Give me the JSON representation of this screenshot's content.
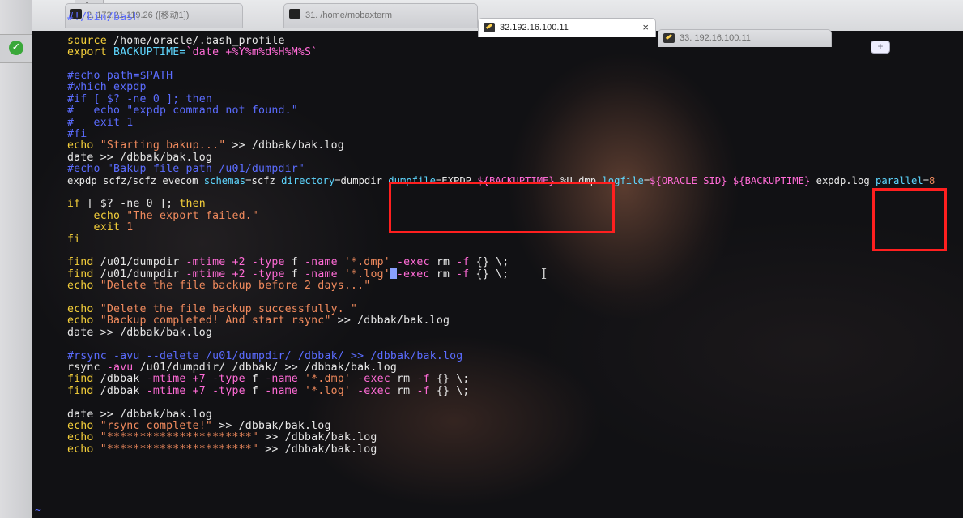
{
  "tabs": [
    {
      "label": "2. 172.21.119.26 ([移动1])",
      "active": false
    },
    {
      "label": "31. /home/mobaxterm",
      "active": false
    },
    {
      "label": "32.192.16.100.11",
      "active": true,
      "close": "×"
    },
    {
      "label": "33. 192.16.100.11",
      "active": false
    }
  ],
  "newtab_label": "+",
  "status_icon": "check-circle-icon",
  "terminal": {
    "lines": [
      [
        {
          "t": "#!/bin/bash",
          "c": "com"
        }
      ],
      [],
      [
        {
          "t": "source",
          "c": "kw"
        },
        {
          "t": " /home/oracle/.bash_profile",
          "c": "txt"
        }
      ],
      [
        {
          "t": "export",
          "c": "kw"
        },
        {
          "t": " BACKUPTIME=",
          "c": "var"
        },
        {
          "t": "`date +%Y%m%d%H%M%S`",
          "c": "opt"
        }
      ],
      [],
      [
        {
          "t": "#echo path=$PATH",
          "c": "com"
        }
      ],
      [
        {
          "t": "#which expdp",
          "c": "com"
        }
      ],
      [
        {
          "t": "#if [ $? -ne 0 ]; then",
          "c": "com"
        }
      ],
      [
        {
          "t": "#   echo \"expdp command not found.\"",
          "c": "com"
        }
      ],
      [
        {
          "t": "#   exit 1",
          "c": "com"
        }
      ],
      [
        {
          "t": "#fi",
          "c": "com"
        }
      ],
      [
        {
          "t": "echo",
          "c": "kw"
        },
        {
          "t": " \"Starting bakup...\"",
          "c": "str"
        },
        {
          "t": " >> /dbbak/bak.log",
          "c": "txt"
        }
      ],
      [
        {
          "t": "date >> /dbbak/bak.log",
          "c": "txt"
        }
      ],
      [
        {
          "t": "#echo \"Bakup file path /u01/dumpdir\"",
          "c": "com"
        }
      ],
      [
        {
          "t": "expdp scfz/scfz_evecom ",
          "c": "txt"
        },
        {
          "t": "schemas",
          "c": "var"
        },
        {
          "t": "=scfz ",
          "c": "txt"
        },
        {
          "t": "directory",
          "c": "var"
        },
        {
          "t": "=dumpdir ",
          "c": "txt"
        },
        {
          "t": "dumpfile",
          "c": "var"
        },
        {
          "t": "=EXPDP_",
          "c": "txt"
        },
        {
          "t": "${BACKUPTIME}",
          "c": "opt"
        },
        {
          "t": "_%U.dmp ",
          "c": "txt"
        },
        {
          "t": "logfile",
          "c": "var"
        },
        {
          "t": "=",
          "c": "txt"
        },
        {
          "t": "${ORACLE_SID}",
          "c": "opt"
        },
        {
          "t": "_",
          "c": "txt"
        },
        {
          "t": "${BACKUPTIME}",
          "c": "opt"
        },
        {
          "t": "_expdp.log ",
          "c": "txt"
        },
        {
          "t": "parallel",
          "c": "var"
        },
        {
          "t": "=",
          "c": "txt"
        },
        {
          "t": "8",
          "c": "str"
        }
      ],
      [],
      [
        {
          "t": "if",
          "c": "kw"
        },
        {
          "t": " [ $? -ne 0 ]; ",
          "c": "txt"
        },
        {
          "t": "then",
          "c": "kw"
        }
      ],
      [
        {
          "t": "    echo",
          "c": "kw"
        },
        {
          "t": " \"The export failed.\"",
          "c": "str"
        }
      ],
      [
        {
          "t": "    exit",
          "c": "kw"
        },
        {
          "t": " 1",
          "c": "str"
        }
      ],
      [
        {
          "t": "fi",
          "c": "kw"
        }
      ],
      [],
      [
        {
          "t": "find",
          "c": "kw"
        },
        {
          "t": " /u01/dumpdir ",
          "c": "txt"
        },
        {
          "t": "-mtime +2 -type",
          "c": "opt"
        },
        {
          "t": " f ",
          "c": "txt"
        },
        {
          "t": "-name",
          "c": "opt"
        },
        {
          "t": " '*.dmp' ",
          "c": "str"
        },
        {
          "t": "-exec",
          "c": "opt"
        },
        {
          "t": " rm ",
          "c": "txt"
        },
        {
          "t": "-f",
          "c": "opt"
        },
        {
          "t": " {} \\;",
          "c": "txt"
        }
      ],
      [
        {
          "t": "find",
          "c": "kw"
        },
        {
          "t": " /u01/dumpdir ",
          "c": "txt"
        },
        {
          "t": "-mtime +2 -type",
          "c": "opt"
        },
        {
          "t": " f ",
          "c": "txt"
        },
        {
          "t": "-name",
          "c": "opt"
        },
        {
          "t": " '*.log'",
          "c": "str"
        },
        {
          "t": "CURSOR",
          "c": "cur"
        },
        {
          "t": "-exec",
          "c": "opt"
        },
        {
          "t": " rm ",
          "c": "txt"
        },
        {
          "t": "-f",
          "c": "opt"
        },
        {
          "t": " {} \\;",
          "c": "txt"
        }
      ],
      [
        {
          "t": "echo",
          "c": "kw"
        },
        {
          "t": " \"Delete the file backup before 2 days...\"",
          "c": "str"
        }
      ],
      [],
      [
        {
          "t": "echo",
          "c": "kw"
        },
        {
          "t": " \"Delete the file backup successfully. \"",
          "c": "str"
        }
      ],
      [
        {
          "t": "echo",
          "c": "kw"
        },
        {
          "t": " \"Backup completed! And start rsync\"",
          "c": "str"
        },
        {
          "t": " >> /dbbak/bak.log",
          "c": "txt"
        }
      ],
      [
        {
          "t": "date >> /dbbak/bak.log",
          "c": "txt"
        }
      ],
      [],
      [
        {
          "t": "#rsync -avu --delete /u01/dumpdir/ /dbbak/ >> /dbbak/bak.log",
          "c": "com"
        }
      ],
      [
        {
          "t": "rsync ",
          "c": "txt"
        },
        {
          "t": "-avu",
          "c": "opt"
        },
        {
          "t": " /u01/dumpdir/ /dbbak/ >> /dbbak/bak.log",
          "c": "txt"
        }
      ],
      [
        {
          "t": "find",
          "c": "kw"
        },
        {
          "t": " /dbbak ",
          "c": "txt"
        },
        {
          "t": "-mtime +7 -type",
          "c": "opt"
        },
        {
          "t": " f ",
          "c": "txt"
        },
        {
          "t": "-name",
          "c": "opt"
        },
        {
          "t": " '*.dmp' ",
          "c": "str"
        },
        {
          "t": "-exec",
          "c": "opt"
        },
        {
          "t": " rm ",
          "c": "txt"
        },
        {
          "t": "-f",
          "c": "opt"
        },
        {
          "t": " {} \\;",
          "c": "txt"
        }
      ],
      [
        {
          "t": "find",
          "c": "kw"
        },
        {
          "t": " /dbbak ",
          "c": "txt"
        },
        {
          "t": "-mtime +7 -type",
          "c": "opt"
        },
        {
          "t": " f ",
          "c": "txt"
        },
        {
          "t": "-name",
          "c": "opt"
        },
        {
          "t": " '*.log' ",
          "c": "str"
        },
        {
          "t": "-exec",
          "c": "opt"
        },
        {
          "t": " rm ",
          "c": "txt"
        },
        {
          "t": "-f",
          "c": "opt"
        },
        {
          "t": " {} \\;",
          "c": "txt"
        }
      ],
      [],
      [
        {
          "t": "date >> /dbbak/bak.log",
          "c": "txt"
        }
      ],
      [
        {
          "t": "echo",
          "c": "kw"
        },
        {
          "t": " \"rsync complete!\"",
          "c": "str"
        },
        {
          "t": " >> /dbbak/bak.log",
          "c": "txt"
        }
      ],
      [
        {
          "t": "echo",
          "c": "kw"
        },
        {
          "t": " \"**********************\"",
          "c": "str"
        },
        {
          "t": " >> /dbbak/bak.log",
          "c": "txt"
        }
      ],
      [
        {
          "t": "echo",
          "c": "kw"
        },
        {
          "t": " \"**********************\"",
          "c": "str"
        },
        {
          "t": " >> /dbbak/bak.log",
          "c": "txt"
        }
      ]
    ],
    "tilde": "~"
  },
  "colors": {
    "comment": "#5b6cff",
    "keyword": "#f4cf3a",
    "variable": "#5fd7ff",
    "string": "#f08a5d",
    "option": "#ff6bd6",
    "highlight_box": "#ff1f1f"
  }
}
